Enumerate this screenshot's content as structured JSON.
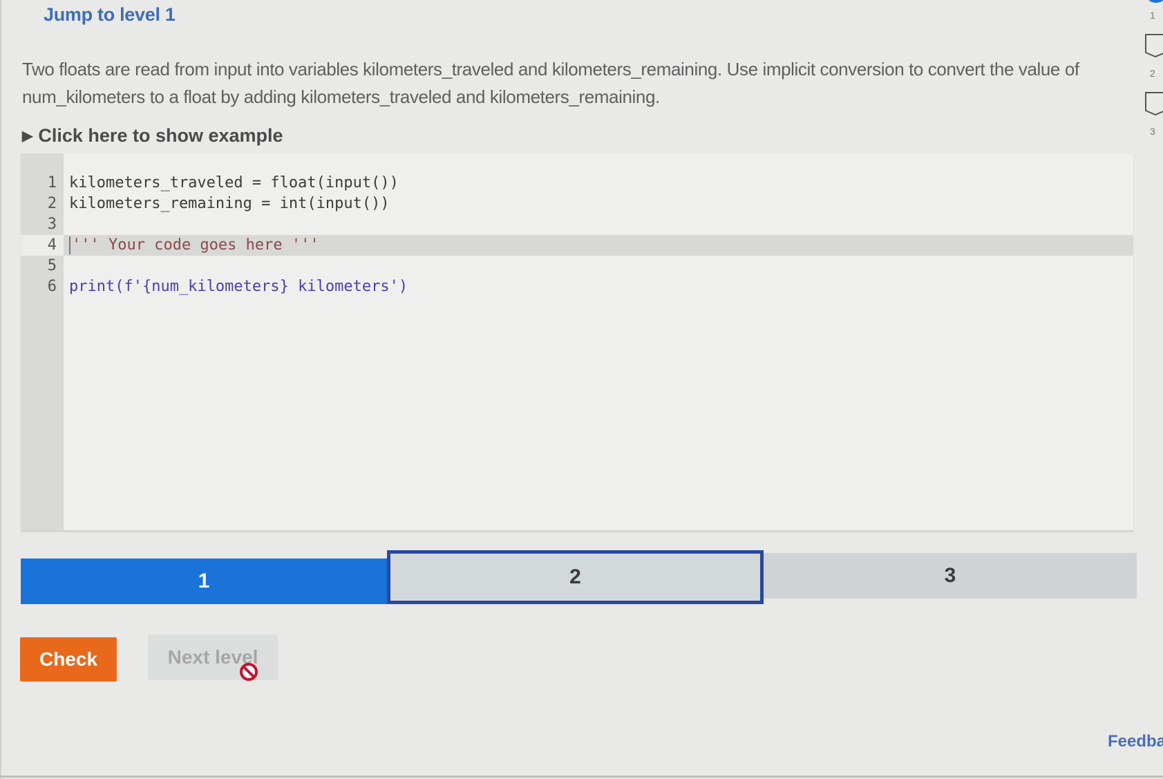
{
  "header": {
    "jump_title": "Jump to level 1"
  },
  "prompt": {
    "text": "Two floats are read from input into variables kilometers_traveled and kilometers_remaining. Use implicit conversion to convert the value of num_kilometers to a float by adding kilometers_traveled and kilometers_remaining."
  },
  "example_toggle": {
    "label": "Click here to show example"
  },
  "editor": {
    "lines": [
      {
        "num": "1",
        "code": "kilometers_traveled = float(input())"
      },
      {
        "num": "2",
        "code": "kilometers_remaining = int(input())"
      },
      {
        "num": "3",
        "code": ""
      },
      {
        "num": "4",
        "code": "''' Your code goes here '''"
      },
      {
        "num": "5",
        "code": ""
      },
      {
        "num": "6",
        "code": "print(f'{num_kilometers} kilometers')"
      }
    ],
    "active_line": 4
  },
  "levels": {
    "items": [
      {
        "label": "1",
        "state": "completed"
      },
      {
        "label": "2",
        "state": "current"
      },
      {
        "label": "3",
        "state": "locked"
      }
    ]
  },
  "buttons": {
    "check": "Check",
    "next_level": "Next level"
  },
  "side_progress": {
    "items": [
      "1",
      "2",
      "3"
    ]
  },
  "footer": {
    "feedback": "Feedba"
  },
  "colors": {
    "accent_blue": "#1a73d9",
    "current_border": "#2b47a0",
    "check_orange": "#e8691b",
    "title_blue": "#3f6eb5"
  }
}
